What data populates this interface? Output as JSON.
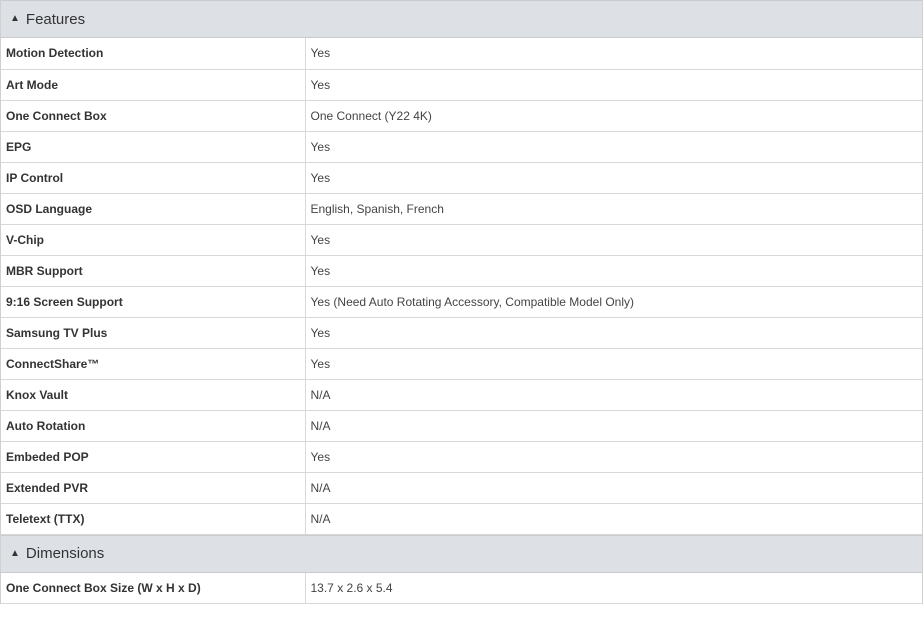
{
  "sections": [
    {
      "title": "Features",
      "rows": [
        {
          "key": "Motion Detection",
          "value": "Yes"
        },
        {
          "key": "Art Mode",
          "value": "Yes"
        },
        {
          "key": "One Connect Box",
          "value": "One Connect (Y22 4K)"
        },
        {
          "key": "EPG",
          "value": "Yes"
        },
        {
          "key": "IP Control",
          "value": "Yes"
        },
        {
          "key": "OSD Language",
          "value": "English, Spanish, French"
        },
        {
          "key": "V-Chip",
          "value": "Yes"
        },
        {
          "key": "MBR Support",
          "value": "Yes"
        },
        {
          "key": "9:16 Screen Support",
          "value": "Yes (Need Auto Rotating Accessory, Compatible Model Only)"
        },
        {
          "key": "Samsung TV Plus",
          "value": "Yes"
        },
        {
          "key": "ConnectShare™",
          "value": "Yes"
        },
        {
          "key": "Knox Vault",
          "value": "N/A"
        },
        {
          "key": "Auto Rotation",
          "value": "N/A"
        },
        {
          "key": "Embeded POP",
          "value": "Yes"
        },
        {
          "key": "Extended PVR",
          "value": "N/A"
        },
        {
          "key": "Teletext (TTX)",
          "value": "N/A"
        }
      ]
    },
    {
      "title": "Dimensions",
      "rows": [
        {
          "key": "One Connect Box Size (W x H x D)",
          "value": "13.7 x 2.6 x 5.4"
        }
      ]
    }
  ],
  "icons": {
    "collapse": "triangle-up-icon"
  }
}
